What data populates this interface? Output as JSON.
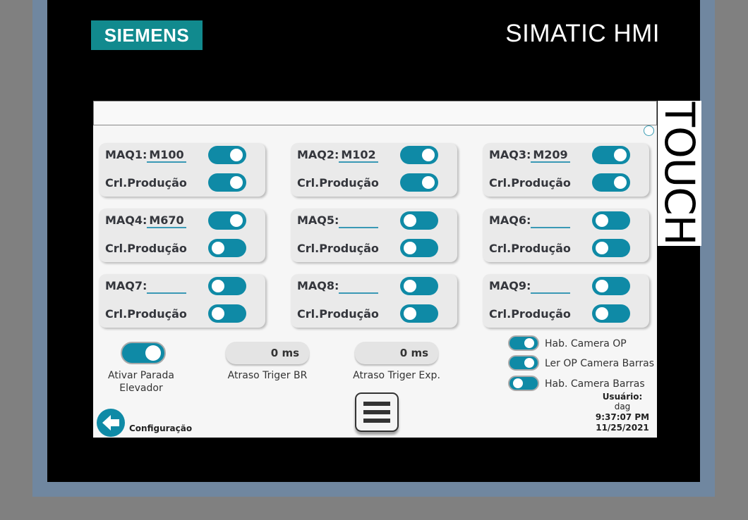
{
  "brand": {
    "logo_text": "SIEMENS",
    "product": "SIMATIC HMI",
    "side_label": "TOUCH"
  },
  "colors": {
    "accent": "#0f8aa6",
    "bezel": "#7087a0",
    "logo_bg": "#118a8e"
  },
  "machines": [
    {
      "label": "MAQ1:",
      "value": "M100",
      "toggle": "on",
      "prod_label": "Crl.Produção",
      "prod_toggle": "on"
    },
    {
      "label": "MAQ2:",
      "value": "M102",
      "toggle": "on",
      "prod_label": "Crl.Produção",
      "prod_toggle": "on"
    },
    {
      "label": "MAQ3:",
      "value": "M209",
      "toggle": "on",
      "prod_label": "Crl.Produção",
      "prod_toggle": "on"
    },
    {
      "label": "MAQ4:",
      "value": "M670",
      "toggle": "on",
      "prod_label": "Crl.Produção",
      "prod_toggle": "off"
    },
    {
      "label": "MAQ5:",
      "value": "",
      "toggle": "off",
      "prod_label": "Crl.Produção",
      "prod_toggle": "off"
    },
    {
      "label": "MAQ6:",
      "value": "",
      "toggle": "off",
      "prod_label": "Crl.Produção",
      "prod_toggle": "off"
    },
    {
      "label": "MAQ7:",
      "value": "",
      "toggle": "off",
      "prod_label": "Crl.Produção",
      "prod_toggle": "off"
    },
    {
      "label": "MAQ8:",
      "value": "",
      "toggle": "off",
      "prod_label": "Crl.Produção",
      "prod_toggle": "off"
    },
    {
      "label": "MAQ9:",
      "value": "",
      "toggle": "off",
      "prod_label": "Crl.Produção",
      "prod_toggle": "off"
    }
  ],
  "elevator": {
    "label_line1": "Ativar Parada",
    "label_line2": "Elevador",
    "toggle": "on"
  },
  "delays": [
    {
      "value": "0 ms",
      "label": "Atraso Triger BR"
    },
    {
      "value": "0 ms",
      "label": "Atraso Triger Exp."
    }
  ],
  "camera_options": [
    {
      "label": "Hab. Camera OP",
      "toggle": "on"
    },
    {
      "label": "Ler OP Camera Barras",
      "toggle": "on"
    },
    {
      "label": "Hab. Camera Barras",
      "toggle": "off"
    }
  ],
  "footer": {
    "back_label": "Configuração",
    "menu_icon": "hamburger-menu-icon",
    "back_icon": "arrow-left-icon",
    "user_label": "Usuário:",
    "user": "dag",
    "time": "9:37:07 PM",
    "date": "11/25/2021"
  }
}
